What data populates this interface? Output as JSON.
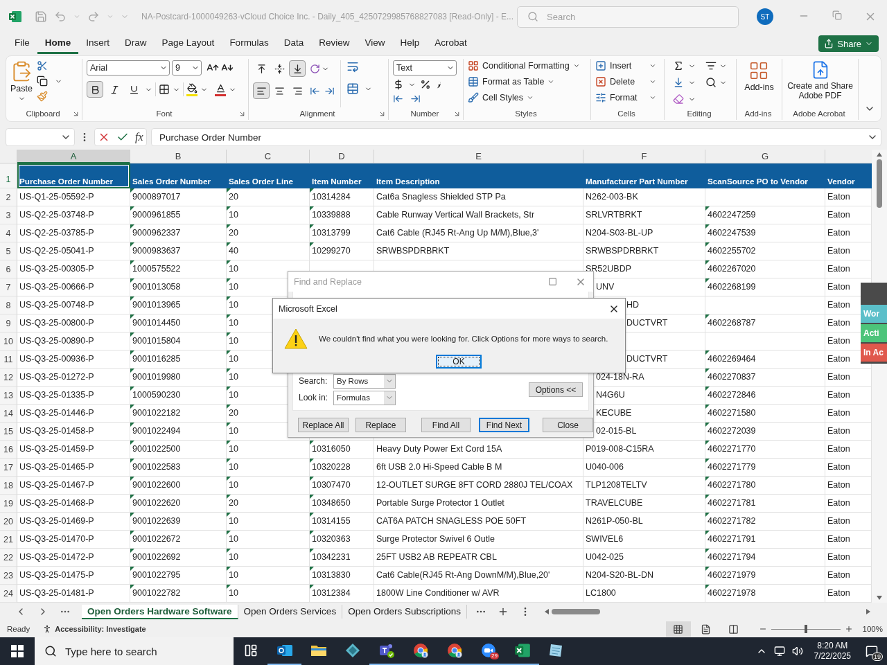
{
  "title_bar": {
    "document_title": "NA-Postcard-1000049263-vCloud Choice Inc. - Daily_405_4250729985768827083  [Read-Only]  -  E...",
    "search_placeholder": "Search",
    "avatar": "ST"
  },
  "menu_tabs": [
    {
      "label": "File",
      "selected": false
    },
    {
      "label": "Home",
      "selected": true
    },
    {
      "label": "Insert",
      "selected": false
    },
    {
      "label": "Draw",
      "selected": false
    },
    {
      "label": "Page Layout",
      "selected": false
    },
    {
      "label": "Formulas",
      "selected": false
    },
    {
      "label": "Data",
      "selected": false
    },
    {
      "label": "Review",
      "selected": false
    },
    {
      "label": "View",
      "selected": false
    },
    {
      "label": "Help",
      "selected": false
    },
    {
      "label": "Acrobat",
      "selected": false
    }
  ],
  "share_button": "Share",
  "ribbon": {
    "clipboard": {
      "paste": "Paste",
      "label": "Clipboard"
    },
    "font": {
      "name": "Arial",
      "size": "9",
      "bold": true,
      "italic": false,
      "underline": false,
      "label": "Font"
    },
    "alignment": {
      "vertical": [
        {
          "selected": false
        },
        {
          "selected": false
        },
        {
          "selected": true
        }
      ],
      "horizontal": [
        {
          "selected": true
        },
        {
          "selected": false
        },
        {
          "selected": false
        }
      ],
      "label": "Alignment"
    },
    "number": {
      "format": "Text",
      "label": "Number"
    },
    "styles": {
      "items": [
        "Conditional Formatting",
        "Format as Table",
        "Cell Styles"
      ],
      "label": "Styles"
    },
    "cells": {
      "items": [
        "Insert",
        "Delete",
        "Format"
      ],
      "label": "Cells"
    },
    "editing": {
      "label": "Editing"
    },
    "addins": {
      "button": "Add-ins",
      "label": "Add-ins"
    },
    "acrobat": {
      "button": "Create and Share Adobe PDF",
      "label": "Adobe Acrobat"
    }
  },
  "formula_bar": {
    "fx": "fx",
    "content": "Purchase Order Number"
  },
  "sheet": {
    "header_row_number": "1",
    "columns": [
      {
        "letter": "A",
        "header": "Purchase Order Number",
        "selected": true,
        "error_flag": false
      },
      {
        "letter": "B",
        "header": "Sales Order Number",
        "selected": false,
        "error_flag": true
      },
      {
        "letter": "C",
        "header": "Sales Order Line",
        "selected": false,
        "error_flag": true
      },
      {
        "letter": "D",
        "header": "Item Number",
        "selected": false,
        "error_flag": true
      },
      {
        "letter": "E",
        "header": "Item Description",
        "selected": false,
        "error_flag": false
      },
      {
        "letter": "F",
        "header": "Manufacturer Part Number",
        "selected": false,
        "error_flag": false
      },
      {
        "letter": "G",
        "header": "ScanSource PO to Vendor",
        "selected": false,
        "error_flag": true
      },
      {
        "header": "Vendor",
        "selected": false,
        "error_flag": false
      }
    ],
    "rows": [
      {
        "num": "2",
        "cells": [
          "US-Q1-25-05592-P",
          "9000897017",
          "20",
          "10314284",
          "Cat6a Snagless Shielded STP Pa",
          "N262-003-BK",
          null,
          "Eaton"
        ]
      },
      {
        "num": "3",
        "cells": [
          "US-Q2-25-03748-P",
          "9000961855",
          "10",
          "10339888",
          "Cable Runway Vertical Wall Brackets, Str",
          "SRLVRTBRKT",
          "4602247259",
          "Eaton"
        ]
      },
      {
        "num": "4",
        "cells": [
          "US-Q2-25-03785-P",
          "9000962337",
          "20",
          "10313799",
          "Cat6 Cable (RJ45 Rt-Ang Up M/M),Blue,3'",
          "N204-S03-BL-UP",
          "4602247539",
          "Eaton"
        ]
      },
      {
        "num": "5",
        "cells": [
          "US-Q2-25-05041-P",
          "9000983637",
          "40",
          "10299270",
          "SRWBSPDRBRKT",
          "SRWBSPDRBRKT",
          "4602255702",
          "Eaton"
        ]
      },
      {
        "num": "6",
        "cells": [
          "US-Q3-25-00305-P",
          "1000575522",
          "10",
          null,
          null,
          "SR52UBDP",
          "4602267020",
          "Eaton"
        ]
      },
      {
        "num": "7",
        "cells": [
          "US-Q3-25-00666-P",
          "9001013058",
          "10",
          null,
          null,
          "UNV",
          "4602268199",
          "Eaton"
        ]
      },
      {
        "num": "8",
        "cells": [
          "US-Q3-25-00748-P",
          "9001013965",
          "10",
          null,
          null,
          "HD",
          null,
          "Eaton"
        ]
      },
      {
        "num": "9",
        "cells": [
          "US-Q3-25-00800-P",
          "9001014450",
          "10",
          null,
          null,
          "DUCTVRT",
          "4602268787",
          "Eaton"
        ]
      },
      {
        "num": "10",
        "cells": [
          "US-Q3-25-00890-P",
          "9001015804",
          "10",
          null,
          null,
          null,
          null,
          "Eaton"
        ]
      },
      {
        "num": "11",
        "cells": [
          "US-Q3-25-00936-P",
          "9001016285",
          "10",
          null,
          null,
          "DUCTVRT",
          "4602269464",
          "Eaton"
        ]
      },
      {
        "num": "12",
        "cells": [
          "US-Q3-25-01272-P",
          "9001019980",
          "10",
          null,
          null,
          "024-18N-RA",
          "4602270837",
          "Eaton"
        ]
      },
      {
        "num": "13",
        "cells": [
          "US-Q3-25-01335-P",
          "1000590230",
          "10",
          null,
          null,
          "N4G6U",
          "4602272846",
          "Eaton"
        ]
      },
      {
        "num": "14",
        "cells": [
          "US-Q3-25-01446-P",
          "9001022182",
          "20",
          null,
          null,
          "KECUBE",
          "4602271580",
          "Eaton"
        ]
      },
      {
        "num": "15",
        "cells": [
          "US-Q3-25-01458-P",
          "9001022494",
          "10",
          null,
          null,
          "02-015-BL",
          "4602272039",
          "Eaton"
        ]
      },
      {
        "num": "16",
        "cells": [
          "US-Q3-25-01459-P",
          "9001022500",
          "10",
          "10316050",
          "Heavy Duty Power Ext Cord 15A",
          "P019-008-C15RA",
          "4602271770",
          "Eaton"
        ]
      },
      {
        "num": "17",
        "cells": [
          "US-Q3-25-01465-P",
          "9001022583",
          "10",
          "10320228",
          "6ft USB 2.0 Hi-Speed Cable B M",
          "U040-006",
          "4602271779",
          "Eaton"
        ]
      },
      {
        "num": "18",
        "cells": [
          "US-Q3-25-01467-P",
          "9001022600",
          "10",
          "10307470",
          "12-OUTLET SURGE 8FT CORD 2880J TEL/COAX",
          "TLP1208TELTV",
          "4602271780",
          "Eaton"
        ]
      },
      {
        "num": "19",
        "cells": [
          "US-Q3-25-01468-P",
          "9001022620",
          "20",
          "10348650",
          "Portable Surge Protector 1 Outlet",
          "TRAVELCUBE",
          "4602271781",
          "Eaton"
        ]
      },
      {
        "num": "20",
        "cells": [
          "US-Q3-25-01469-P",
          "9001022639",
          "10",
          "10314155",
          "CAT6A PATCH SNAGLESS POE 50FT",
          "N261P-050-BL",
          "4602271782",
          "Eaton"
        ]
      },
      {
        "num": "21",
        "cells": [
          "US-Q3-25-01470-P",
          "9001022672",
          "10",
          "10320363",
          "Surge Protector Swivel 6 Outle",
          "SWIVEL6",
          "4602271791",
          "Eaton"
        ]
      },
      {
        "num": "22",
        "cells": [
          "US-Q3-25-01472-P",
          "9001022692",
          "10",
          "10342231",
          "25FT USB2 AB REPEATR CBL",
          "U042-025",
          "4602271794",
          "Eaton"
        ]
      },
      {
        "num": "23",
        "cells": [
          "US-Q3-25-01475-P",
          "9001022795",
          "10",
          "10313830",
          "Cat6 Cable(RJ45 Rt-Ang DownM/M),Blue,20'",
          "N204-S20-BL-DN",
          "4602271979",
          "Eaton"
        ]
      },
      {
        "num": "24",
        "cells": [
          "US-Q3-25-01481-P",
          "9001022782",
          "10",
          "10312384",
          "1800W Line Conditioner w/ AVR",
          "LC1800",
          "4602271978",
          "Eaton"
        ]
      }
    ]
  },
  "find_dialog": {
    "title": "Find and Replace",
    "search_label": "Search:",
    "search_value": "By Rows",
    "look_in_label": "Look in:",
    "look_in_value": "Formulas",
    "options_button": "Options <<",
    "buttons": [
      {
        "label": "Replace All",
        "selected": false
      },
      {
        "label": "Replace",
        "selected": false
      },
      {
        "label": "Find All",
        "selected": false
      },
      {
        "label": "Find Next",
        "selected": true
      },
      {
        "label": "Close",
        "selected": false
      }
    ]
  },
  "alert": {
    "title": "Microsoft Excel",
    "message": "We couldn't find what you were looking for. Click Options for more ways to search.",
    "ok": "OK"
  },
  "side_panel": [
    {
      "label": "Wor",
      "color": "#5bbfc9"
    },
    {
      "label": "Acti",
      "color": "#4cc47a"
    },
    {
      "label": "In Ac",
      "color": "#e0584c"
    }
  ],
  "sheet_tabs": [
    {
      "label": "Open Orders Hardware Software",
      "selected": true
    },
    {
      "label": "Open Orders Services",
      "selected": false
    },
    {
      "label": "Open Orders Subscriptions",
      "selected": false
    }
  ],
  "status_bar": {
    "status": "Ready",
    "accessibility": "Accessibility: Investigate",
    "view_buttons": [
      {
        "kind": "normal",
        "selected": true
      },
      {
        "kind": "page_layout",
        "selected": false
      },
      {
        "kind": "page_break",
        "selected": false
      }
    ],
    "zoom_slider": {
      "level": 0.5
    },
    "zoom": "100%"
  },
  "taskbar": {
    "search_placeholder": "Type here to search",
    "apps": [
      {
        "kind": "outlook",
        "running": true
      },
      {
        "kind": "explorer",
        "running": false
      },
      {
        "kind": "diamond",
        "running": false
      },
      {
        "kind": "teams",
        "running": true
      },
      {
        "kind": "chrome",
        "running": true
      },
      {
        "kind": "chrome",
        "running": true
      },
      {
        "kind": "zoom",
        "running": true,
        "badge": "29"
      },
      {
        "kind": "excel",
        "running": true
      },
      {
        "kind": "notepad",
        "running": false
      }
    ],
    "time": "8:20 AM",
    "date": "7/22/2025",
    "notifications": "19"
  }
}
